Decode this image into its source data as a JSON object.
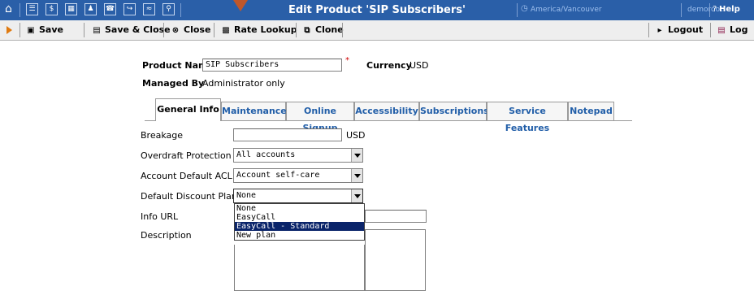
{
  "header": {
    "title": "Edit Product 'SIP Subscribers'",
    "timezone": "America/Vancouver",
    "user": "demoroot",
    "help": "Help",
    "nav_icons": [
      "home-icon",
      "list-icon",
      "dollar-icon",
      "grid-icon",
      "person-icon",
      "phone-icon",
      "gateway-icon",
      "chart-icon",
      "search-icon"
    ]
  },
  "toolbar": {
    "save": "Save",
    "save_close": "Save & Close",
    "close": "Close",
    "rate_lookup": "Rate Lookup",
    "clone": "Clone",
    "logout": "Logout",
    "log": "Log"
  },
  "product": {
    "name_label": "Product Name",
    "name_value": "SIP Subscribers",
    "currency_label": "Currency",
    "currency_value": "USD",
    "managed_by_label": "Managed By",
    "managed_by_value": "Administrator only"
  },
  "tabs": [
    "General Info",
    "Maintenance",
    "Online Signup",
    "Accessibility",
    "Subscriptions",
    "Service Features",
    "Notepad"
  ],
  "general": {
    "breakage_label": "Breakage",
    "breakage_value": "",
    "breakage_unit": "USD",
    "overdraft_label": "Overdraft Protection",
    "overdraft_value": "All accounts",
    "acl_label": "Account Default ACL",
    "acl_value": "Account self-care",
    "discount_label": "Default Discount Plan",
    "discount_value": "None",
    "discount_options": [
      "None",
      "EasyCall",
      "EasyCall - Standard",
      "New plan"
    ],
    "discount_highlighted": "EasyCall - Standard",
    "info_url_label": "Info URL",
    "info_url_value": "",
    "description_label": "Description"
  },
  "colors": {
    "header_bg": "#2a5fa8",
    "tab_text": "#215ea8",
    "highlight": "#0a246a"
  }
}
